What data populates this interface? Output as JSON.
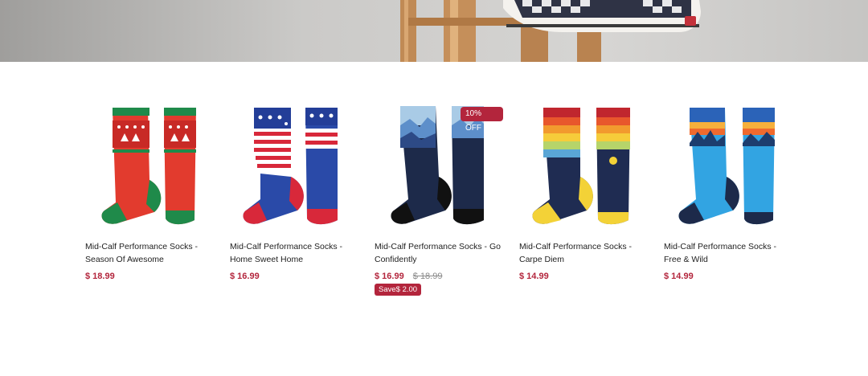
{
  "hero": {
    "image": "person-on-wooden-stool-checkered-sneaker"
  },
  "colors": {
    "accent": "#b3253c",
    "compare": "#8a8a8a",
    "text": "#1f1f1f"
  },
  "products": [
    {
      "name": "Mid-Calf Performance Socks - Season Of Awesome",
      "price": "$ 18.99",
      "image": "christmas-sweater-socks"
    },
    {
      "name": "Mid-Calf Performance Socks - Home Sweet Home",
      "price": "$ 16.99",
      "image": "stars-and-stripes-socks"
    },
    {
      "name": "Mid-Calf Performance Socks - Go Confidently",
      "price": "$ 16.99",
      "compare_price": "$ 18.99",
      "discount_badge": "10% OFF",
      "save_badge": "Save$ 2.00",
      "image": "mountain-silhouette-socks"
    },
    {
      "name": "Mid-Calf Performance Socks - Carpe Diem",
      "price": "$ 14.99",
      "image": "sunset-stripe-socks"
    },
    {
      "name": "Mid-Calf Performance Socks - Free & Wild",
      "price": "$ 14.99",
      "image": "sunset-mountain-socks"
    }
  ]
}
